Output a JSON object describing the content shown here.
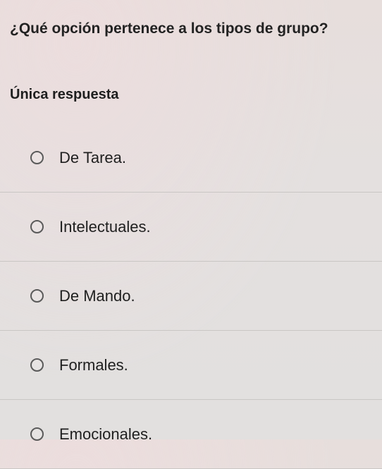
{
  "question": {
    "text": "¿Qué opción pertenece a los tipos de grupo?"
  },
  "answer_mode": "Única respuesta",
  "options": [
    {
      "label": "De Tarea.",
      "selected": false
    },
    {
      "label": "Intelectuales.",
      "selected": false
    },
    {
      "label": "De Mando.",
      "selected": false
    },
    {
      "label": "Formales.",
      "selected": false
    },
    {
      "label": "Emocionales.",
      "selected": false
    }
  ]
}
